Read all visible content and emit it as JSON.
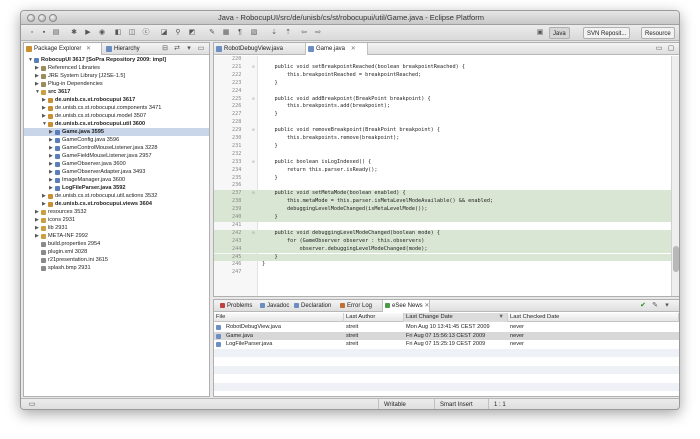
{
  "window": {
    "title": "Java - RobocupUI/src/de/unisb/cs/st/robocupui/util/Game.java - Eclipse Platform"
  },
  "perspectives": [
    {
      "label": "Java",
      "active": true
    },
    {
      "label": "SVN Reposit...",
      "active": false
    },
    {
      "label": "Resource",
      "active": false
    }
  ],
  "left_tabs": [
    {
      "label": "Package Explorer"
    },
    {
      "label": "Hierarchy"
    }
  ],
  "tree": [
    {
      "indent": 0,
      "twisty": "▼",
      "label": "RobocupUI 3617 [SoPra Repository 2009: impl]",
      "bold": true,
      "icon": "#5a7fb8"
    },
    {
      "indent": 1,
      "twisty": "▶",
      "label": "Referenced Libraries",
      "bold": false,
      "icon": "#9c8a5a"
    },
    {
      "indent": 1,
      "twisty": "▶",
      "label": "JRE System Library [J2SE-1.5]",
      "bold": false,
      "icon": "#9c8a5a"
    },
    {
      "indent": 1,
      "twisty": "▶",
      "label": "Plug-in Dependencies",
      "bold": false,
      "icon": "#9c8a5a"
    },
    {
      "indent": 1,
      "twisty": "▼",
      "label": "src 3617",
      "bold": true,
      "icon": "#c8a040"
    },
    {
      "indent": 2,
      "twisty": "▶",
      "label": "de.unisb.cs.st.robocupui 3617",
      "bold": true,
      "icon": "#c89030"
    },
    {
      "indent": 2,
      "twisty": "▶",
      "label": "de.unisb.cs.st.robocupui.components 3471",
      "bold": false,
      "icon": "#c89030"
    },
    {
      "indent": 2,
      "twisty": "▶",
      "label": "de.unisb.cs.st.robocupui.model 3507",
      "bold": false,
      "icon": "#c89030"
    },
    {
      "indent": 2,
      "twisty": "▼",
      "label": "de.unisb.cs.st.robocupui.util 3600",
      "bold": true,
      "icon": "#c89030"
    },
    {
      "indent": 3,
      "twisty": "▶",
      "label": "Game.java 3595",
      "bold": true,
      "icon": "#5a7fb8",
      "selected": true
    },
    {
      "indent": 3,
      "twisty": "▶",
      "label": "GameConfig.java 3596",
      "bold": false,
      "icon": "#5a7fb8"
    },
    {
      "indent": 3,
      "twisty": "▶",
      "label": "GameControlMouseListener.java 3228",
      "bold": false,
      "icon": "#5a7fb8"
    },
    {
      "indent": 3,
      "twisty": "▶",
      "label": "GameFieldMouseListener.java 2957",
      "bold": false,
      "icon": "#5a7fb8"
    },
    {
      "indent": 3,
      "twisty": "▶",
      "label": "GameObserver.java 3600",
      "bold": false,
      "icon": "#5a7fb8"
    },
    {
      "indent": 3,
      "twisty": "▶",
      "label": "GameObserverAdapter.java 3493",
      "bold": false,
      "icon": "#5a7fb8"
    },
    {
      "indent": 3,
      "twisty": "▶",
      "label": "ImageManager.java 3600",
      "bold": false,
      "icon": "#5a7fb8"
    },
    {
      "indent": 3,
      "twisty": "▶",
      "label": "LogFileParser.java 3592",
      "bold": true,
      "icon": "#5a7fb8"
    },
    {
      "indent": 2,
      "twisty": "▶",
      "label": "de.unisb.cs.st.robocupui.util.actions 3532",
      "bold": false,
      "icon": "#c89030"
    },
    {
      "indent": 2,
      "twisty": "▶",
      "label": "de.unisb.cs.st.robocupui.views 3604",
      "bold": true,
      "icon": "#c89030"
    },
    {
      "indent": 1,
      "twisty": "▶",
      "label": "resources 3532",
      "bold": false,
      "icon": "#c8a040"
    },
    {
      "indent": 1,
      "twisty": "▶",
      "label": "icons 2931",
      "bold": false,
      "icon": "#c8a040"
    },
    {
      "indent": 1,
      "twisty": "▶",
      "label": "lib 2931",
      "bold": false,
      "icon": "#c8a040"
    },
    {
      "indent": 1,
      "twisty": "▶",
      "label": "META-INF 2992",
      "bold": false,
      "icon": "#c8a040"
    },
    {
      "indent": 1,
      "twisty": "",
      "label": "build.properties 2954",
      "bold": false,
      "icon": "#8a8a8a"
    },
    {
      "indent": 1,
      "twisty": "",
      "label": "plugin.xml 3028",
      "bold": false,
      "icon": "#8a8a8a"
    },
    {
      "indent": 1,
      "twisty": "",
      "label": "r21presentation.ini 3615",
      "bold": false,
      "icon": "#8a8a8a"
    },
    {
      "indent": 1,
      "twisty": "",
      "label": "splash.bmp 2931",
      "bold": false,
      "icon": "#8a8a8a"
    }
  ],
  "editor_tabs": [
    {
      "label": "RobotDebugView.java",
      "active": false
    },
    {
      "label": "Game.java",
      "active": true
    }
  ],
  "code": [
    {
      "n": "220",
      "fold": "",
      "t": "",
      "hl": false
    },
    {
      "n": "221",
      "fold": "⊖",
      "t": "    public void setBreakpointReached(boolean breakpointReached) {",
      "hl": false
    },
    {
      "n": "222",
      "fold": "",
      "t": "        this.breakpointReached = breakpointReached;",
      "hl": false
    },
    {
      "n": "223",
      "fold": "",
      "t": "    }",
      "hl": false
    },
    {
      "n": "224",
      "fold": "",
      "t": "",
      "hl": false
    },
    {
      "n": "225",
      "fold": "⊖",
      "t": "    public void addBreakpoint(BreakPoint breakpoint) {",
      "hl": false
    },
    {
      "n": "226",
      "fold": "",
      "t": "        this.breakpoints.add(breakpoint);",
      "hl": false
    },
    {
      "n": "227",
      "fold": "",
      "t": "    }",
      "hl": false
    },
    {
      "n": "228",
      "fold": "",
      "t": "",
      "hl": false
    },
    {
      "n": "229",
      "fold": "⊖",
      "t": "    public void removeBreakpoint(BreakPoint breakpoint) {",
      "hl": false
    },
    {
      "n": "230",
      "fold": "",
      "t": "        this.breakpoints.remove(breakpoint);",
      "hl": false
    },
    {
      "n": "231",
      "fold": "",
      "t": "    }",
      "hl": false
    },
    {
      "n": "232",
      "fold": "",
      "t": "",
      "hl": false
    },
    {
      "n": "233",
      "fold": "⊖",
      "t": "    public boolean isLogIndexed() {",
      "hl": false
    },
    {
      "n": "234",
      "fold": "",
      "t": "        return this.parser.isReady();",
      "hl": false
    },
    {
      "n": "235",
      "fold": "",
      "t": "    }",
      "hl": false
    },
    {
      "n": "236",
      "fold": "",
      "t": "",
      "hl": false
    },
    {
      "n": "237",
      "fold": "⊖",
      "t": "    public void setMetaMode(boolean enabled) {",
      "hl": true
    },
    {
      "n": "238",
      "fold": "",
      "t": "        this.metaMode = this.parser.isMetaLevelModeAvailable() && enabled;",
      "hl": true
    },
    {
      "n": "239",
      "fold": "",
      "t": "        debuggingLevelModeChanged(isMetaLevelMode());",
      "hl": true
    },
    {
      "n": "240",
      "fold": "",
      "t": "    }",
      "hl": true
    },
    {
      "n": "241",
      "fold": "",
      "t": "",
      "hl": false
    },
    {
      "n": "242",
      "fold": "⊖",
      "t": "    public void debuggingLevelModeChanged(boolean mode) {",
      "hl": true
    },
    {
      "n": "243",
      "fold": "",
      "t": "        for (GameObserver observer : this.observers)",
      "hl": true
    },
    {
      "n": "244",
      "fold": "",
      "t": "            observer.debuggingLevelModeChanged(mode);",
      "hl": true
    },
    {
      "n": "245",
      "fold": "",
      "t": "    }",
      "hl": true
    },
    {
      "n": "246",
      "fold": "",
      "t": "}",
      "hl": false
    },
    {
      "n": "247",
      "fold": "",
      "t": "",
      "hl": false
    }
  ],
  "bottom_tabs": [
    {
      "label": "Problems",
      "icon": "#c04040"
    },
    {
      "label": "Javadoc",
      "icon": "#6a8ec0"
    },
    {
      "label": "Declaration",
      "icon": "#6a8ec0"
    },
    {
      "label": "Error Log",
      "icon": "#c07030"
    },
    {
      "label": "eSee News",
      "icon": "#4a9a4a",
      "active": true
    }
  ],
  "news_table": {
    "columns": [
      "File",
      "Last Author",
      "Last Change Date",
      "Last Checked Date"
    ],
    "rows": [
      {
        "file": "RobotDebugView.java",
        "author": "streit",
        "changed": "Mon Aug 10 13:41:45 CEST 2009",
        "checked": "never"
      },
      {
        "file": "Game.java",
        "author": "streit",
        "changed": "Fri Aug 07 15:56:13 CEST 2009",
        "checked": "never",
        "selected": true
      },
      {
        "file": "LogFileParser.java",
        "author": "streit",
        "changed": "Fri Aug 07 15:25:19 CEST 2009",
        "checked": "never"
      }
    ]
  },
  "status": {
    "writable": "Writable",
    "insert_mode": "Smart Insert",
    "position": "1 : 1"
  }
}
